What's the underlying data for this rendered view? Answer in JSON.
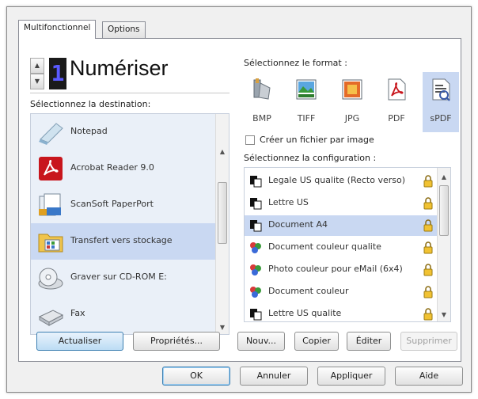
{
  "tabs": [
    {
      "label": "Multifonctionnel",
      "active": true
    },
    {
      "label": "Options",
      "active": false
    }
  ],
  "scan": {
    "counter": "1",
    "title": "Numériser"
  },
  "destination": {
    "label": "Sélectionnez la destination:",
    "items": [
      {
        "label": "Notepad",
        "icon": "notepad-icon",
        "selected": false
      },
      {
        "label": "Acrobat Reader 9.0",
        "icon": "acrobat-icon",
        "selected": false
      },
      {
        "label": "ScanSoft PaperPort",
        "icon": "paperport-icon",
        "selected": false
      },
      {
        "label": "Transfert vers stockage",
        "icon": "storage-transfer-icon",
        "selected": true
      },
      {
        "label": "Graver sur CD-ROM  E:",
        "icon": "cd-rom-icon",
        "selected": false
      },
      {
        "label": "Fax",
        "icon": "fax-icon",
        "selected": false
      }
    ]
  },
  "format": {
    "label": "Sélectionnez le format :",
    "items": [
      {
        "label": "BMP",
        "icon": "bmp-icon",
        "selected": false
      },
      {
        "label": "TIFF",
        "icon": "tiff-icon",
        "selected": false
      },
      {
        "label": "JPG",
        "icon": "jpg-icon",
        "selected": false
      },
      {
        "label": "PDF",
        "icon": "pdf-icon",
        "selected": false
      },
      {
        "label": "sPDF",
        "icon": "spdf-icon",
        "selected": true
      }
    ],
    "checkbox_label": "Créer un fichier par image",
    "checkbox_checked": false
  },
  "configuration": {
    "label": "Sélectionnez la configuration :",
    "items": [
      {
        "label": "Legale US qualite (Recto verso)",
        "icon": "bw-doc-icon",
        "selected": false
      },
      {
        "label": "Lettre US",
        "icon": "bw-doc-icon",
        "selected": false
      },
      {
        "label": "Document A4",
        "icon": "bw-doc-icon",
        "selected": true
      },
      {
        "label": "Document couleur qualite",
        "icon": "color-doc-icon",
        "selected": false
      },
      {
        "label": "Photo couleur pour eMail (6x4)",
        "icon": "color-doc-icon",
        "selected": false
      },
      {
        "label": "Document couleur",
        "icon": "color-doc-icon",
        "selected": false
      },
      {
        "label": "Lettre US qualite",
        "icon": "bw-doc-icon",
        "selected": false
      }
    ]
  },
  "buttons": {
    "refresh": "Actualiser",
    "properties": "Propriétés...",
    "new": "Nouv...",
    "copy": "Copier",
    "edit": "Éditer",
    "delete": "Supprimer",
    "ok": "OK",
    "cancel": "Annuler",
    "apply": "Appliquer",
    "help": "Aide"
  },
  "colors": {
    "selection": "#c9d8f2",
    "counter_digit": "#5a5aff",
    "primary_button": "#bcdcf4"
  }
}
